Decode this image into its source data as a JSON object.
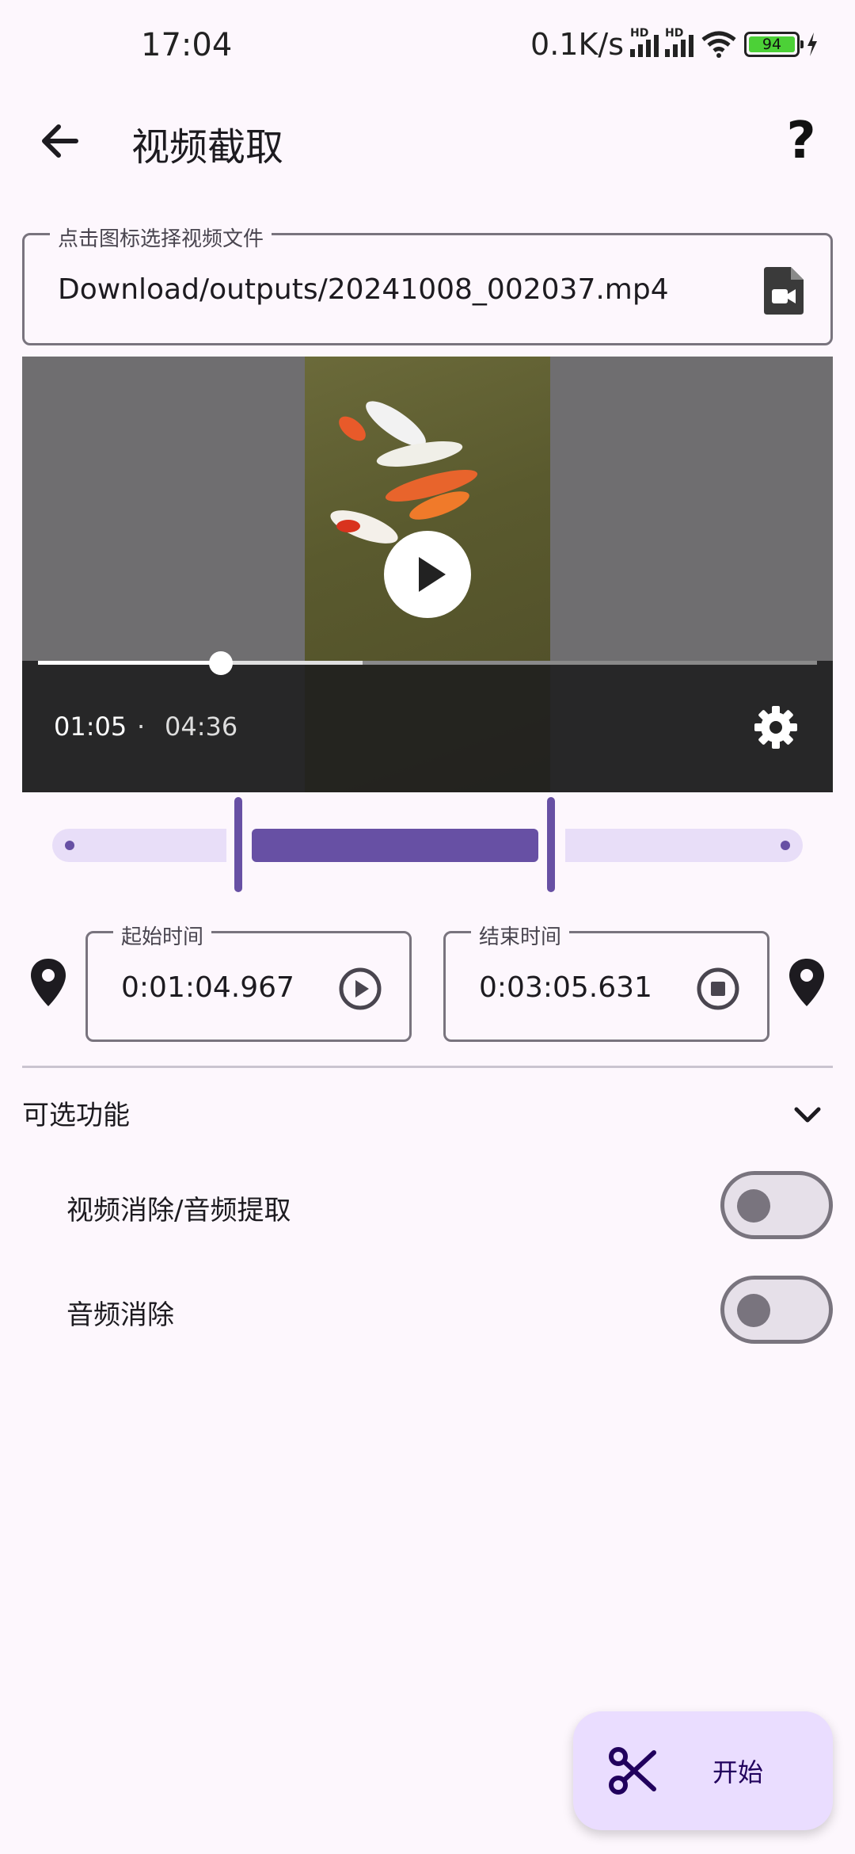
{
  "status_bar": {
    "time": "17:04",
    "network_speed": "0.1K/s",
    "battery_level": "94"
  },
  "app_bar": {
    "title": "视频截取",
    "help_label": "?"
  },
  "file_picker": {
    "legend": "点击图标选择视频文件",
    "value": "Download/outputs/20241008_002037.mp4"
  },
  "player": {
    "current_time": "01:05",
    "separator": "·",
    "duration": "04:36",
    "progress_fraction": 0.235
  },
  "range": {
    "start_fraction": 0.235,
    "end_fraction": 0.657
  },
  "start_time": {
    "legend": "起始时间",
    "value": "0:01:04.967"
  },
  "end_time": {
    "legend": "结束时间",
    "value": "0:03:05.631"
  },
  "optional": {
    "title": "可选功能",
    "items": [
      {
        "label": "视频消除/音频提取",
        "enabled": false
      },
      {
        "label": "音频消除",
        "enabled": false
      }
    ]
  },
  "fab": {
    "label": "开始"
  },
  "colors": {
    "accent": "#6750a4",
    "accent_light": "#e8def8",
    "fab_bg": "#eaddff",
    "background": "#fdf7fd"
  }
}
